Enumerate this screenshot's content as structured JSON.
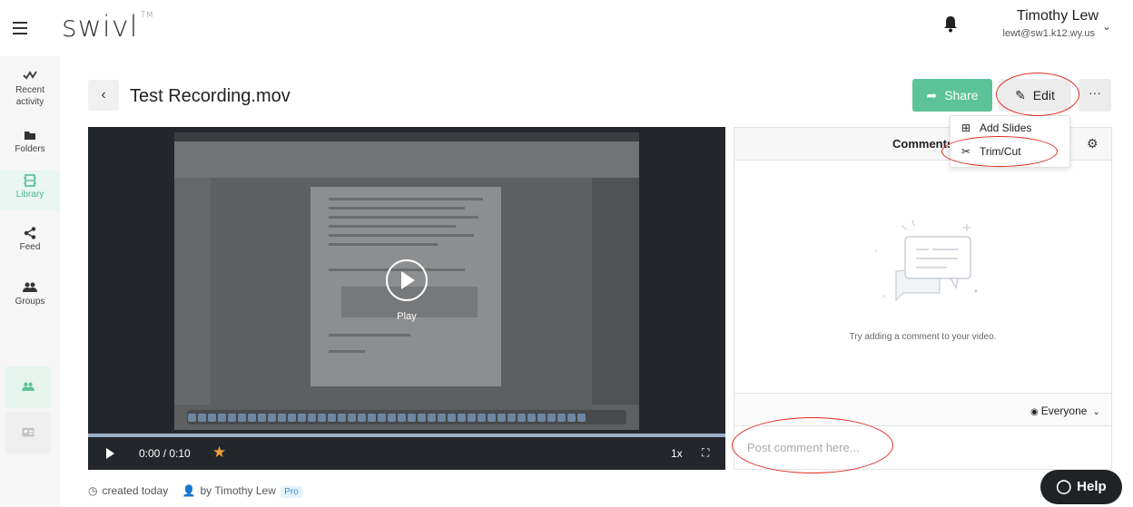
{
  "app": {
    "logo": "swivl",
    "logo_mark": "TM"
  },
  "user": {
    "name": "Timothy Lew",
    "email": "lewt@sw1.k12.wy.us"
  },
  "sidebar": {
    "items": [
      {
        "label": "Recent activity",
        "icon": "activity-icon"
      },
      {
        "label": "Folders",
        "icon": "folder-icon"
      },
      {
        "label": "Library",
        "icon": "film-icon",
        "active": true
      },
      {
        "label": "Feed",
        "icon": "share-icon"
      },
      {
        "label": "Groups",
        "icon": "groups-icon"
      }
    ]
  },
  "header": {
    "title": "Test Recording.mov",
    "share_label": "Share",
    "edit_label": "Edit",
    "more_label": "···"
  },
  "edit_menu": {
    "items": [
      {
        "label": "Add Slides",
        "icon": "add-slides-icon"
      },
      {
        "label": "Trim/Cut",
        "icon": "scissors-icon"
      }
    ]
  },
  "player": {
    "overlay_label": "Play",
    "time": "0:00 / 0:10",
    "speed": "1x"
  },
  "comments": {
    "title": "Comments",
    "empty_message": "Try adding a comment to your video.",
    "audience": "Everyone",
    "input_placeholder": "Post comment here..."
  },
  "meta": {
    "created": "created today",
    "by": "by Timothy Lew",
    "badge": "Pro"
  },
  "help": {
    "label": "Help"
  },
  "colors": {
    "accent": "#5cc297",
    "annotation": "#e02b1e",
    "player_bg": "#23272c"
  }
}
